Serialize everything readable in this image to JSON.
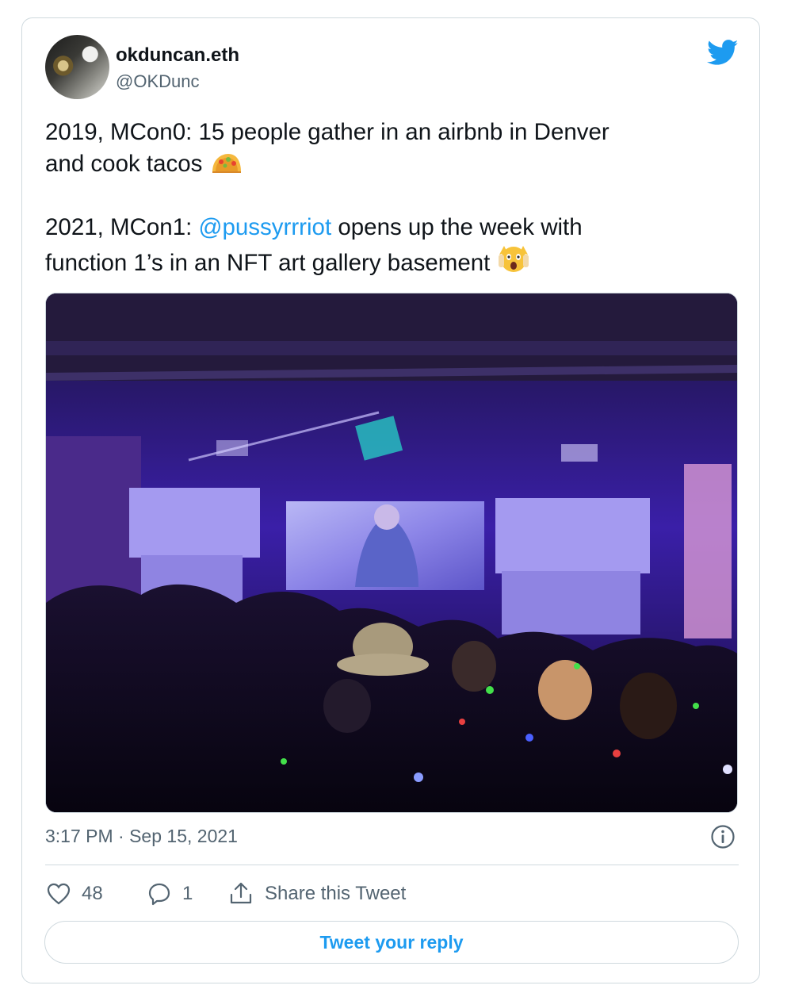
{
  "author": {
    "display_name": "okduncan.eth",
    "handle": "@OKDunc"
  },
  "tweet": {
    "line1": "2019, MCon0: 15 people gather in an airbnb in Denver",
    "line2": "and cook tacos",
    "emoji1": "taco-emoji",
    "line3_prefix": "2021, MCon1: ",
    "mention": "@pussyrrriot",
    "line3_suffix": " opens up the week with",
    "line4": "function 1’s in an NFT art gallery basement",
    "emoji2": "screaming-face-emoji"
  },
  "media": {
    "type": "photo",
    "subject": "basement-party-photo"
  },
  "meta": {
    "timestamp": "3:17 PM · Sep 15, 2021"
  },
  "actions": {
    "like_count": "48",
    "reply_count": "1",
    "share_label": "Share this Tweet"
  },
  "reply": {
    "label": "Tweet your reply"
  },
  "colors": {
    "accent": "#1d9bf0",
    "text": "#0f1419",
    "secondary": "#536471",
    "border": "#cfd9de"
  },
  "icons": [
    "twitter-bird-icon",
    "info-icon",
    "heart-icon",
    "reply-bubble-icon",
    "share-icon"
  ]
}
